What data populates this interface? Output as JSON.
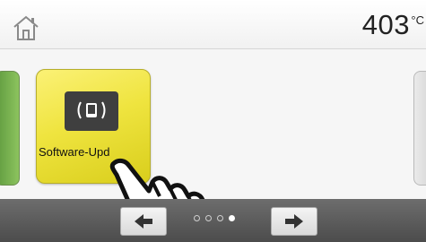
{
  "header": {
    "home_icon": "home-icon",
    "temperature_value": "403",
    "temperature_unit": "°C"
  },
  "main": {
    "tiles": [
      {
        "label": "Software-Upd",
        "icon": "software-update-icon",
        "color": "#efe43f"
      }
    ],
    "pointer_icon": "hand-pointer-icon"
  },
  "footer": {
    "prev_icon": "arrow-left-icon",
    "next_icon": "arrow-right-icon",
    "pagination": {
      "pages": 4,
      "current": 4
    }
  },
  "colors": {
    "tile_yellow": "#efe43f",
    "footer_gray": "#5a5a5a",
    "left_tile_green": "#7ab04f"
  }
}
